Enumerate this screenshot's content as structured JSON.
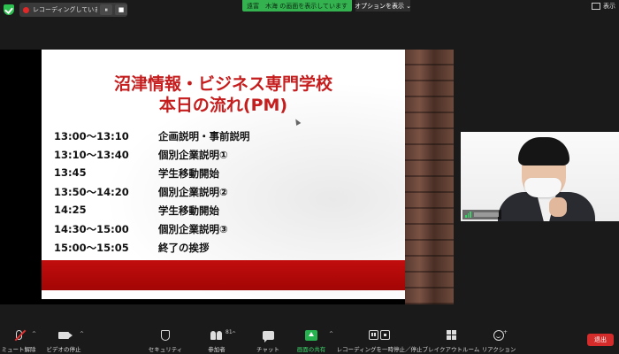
{
  "top_bar": {
    "recording_label": "レコーディングしています...",
    "pause_glyph": "⏸",
    "stop_glyph": "■",
    "viewing_banner": "遠富　木海 の画面を表示しています",
    "options_label": "オプションを表示 ⌄",
    "view_label": "表示"
  },
  "slide": {
    "title_line1": "沼津情報・ビジネス専門学校",
    "title_line2": "本日の流れ(PM)",
    "schedule": [
      {
        "time": "13:00～13:10",
        "event": "企画説明・事前説明"
      },
      {
        "time": "13:10～13:40",
        "event": "個別企業説明①"
      },
      {
        "time": "13:45",
        "event": "学生移動開始"
      },
      {
        "time": "13:50～14:20",
        "event": "個別企業説明②"
      },
      {
        "time": "14:25",
        "event": "学生移動開始"
      },
      {
        "time": "14:30～15:00",
        "event": "個別企業説明③"
      },
      {
        "time": "15:00～15:05",
        "event": "終了の挨拶"
      }
    ]
  },
  "toolbar": {
    "mute_label": "ミュート解除",
    "video_label": "ビデオの停止",
    "security_label": "セキュリティ",
    "participants_label": "参加者",
    "participants_count": "81",
    "chat_label": "チャット",
    "share_label": "画面の共有",
    "recording_label": "レコーディングを一時停止／停止",
    "breakout_label": "ブレイクアウトルーム",
    "reaction_label": "リアクション",
    "leave_label": "退出",
    "caret": "^"
  },
  "colors": {
    "accent_green": "#34b24f",
    "slide_red": "#c51d1d",
    "leave_red": "#d42b2b"
  }
}
